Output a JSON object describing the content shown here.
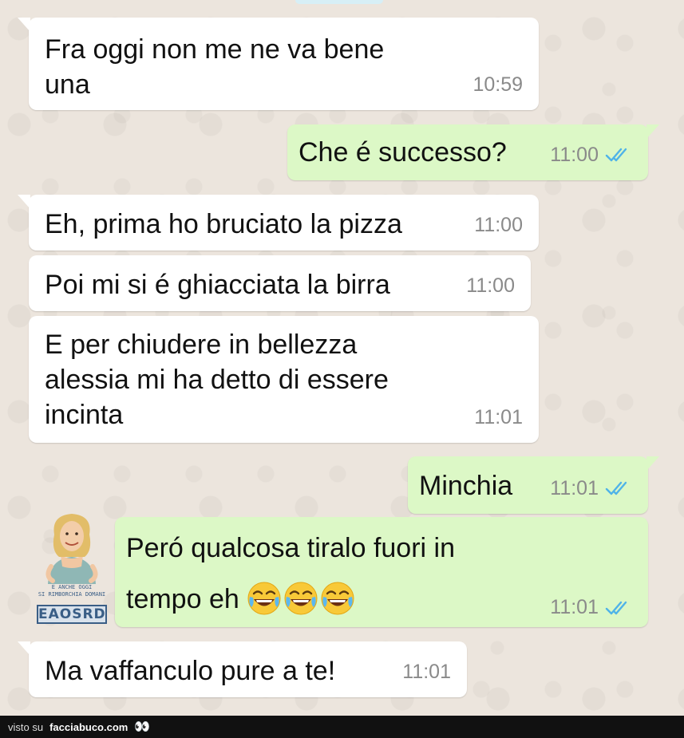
{
  "colors": {
    "incoming_bubble": "#ffffff",
    "outgoing_bubble": "#dcf8c6",
    "chat_background": "#ece5dd",
    "read_ticks": "#4fb3e8",
    "timestamp": "#8a8a8a"
  },
  "messages": [
    {
      "direction": "incoming",
      "text": "Fra oggi non me ne va bene una",
      "time": "10:59"
    },
    {
      "direction": "outgoing",
      "text": "Che é successo?",
      "time": "11:00",
      "status": "read"
    },
    {
      "direction": "incoming",
      "text": "Eh, prima ho bruciato la pizza",
      "time": "11:00"
    },
    {
      "direction": "incoming",
      "text": "Poi mi si é ghiacciata la birra",
      "time": "11:00"
    },
    {
      "direction": "incoming",
      "text": "E per chiudere in bellezza alessia mi ha detto di essere incinta",
      "time": "11:01"
    },
    {
      "direction": "outgoing",
      "text": "Minchia",
      "time": "11:01",
      "status": "read"
    },
    {
      "direction": "outgoing",
      "text_line1": "Peró qualcosa tiralo fuori in",
      "text_line2": "tempo eh",
      "emojis": [
        "face-with-tears-of-joy",
        "face-with-tears-of-joy",
        "face-with-tears-of-joy"
      ],
      "time": "11:01",
      "status": "read"
    },
    {
      "direction": "incoming",
      "text": "Ma vaffanculo pure a te!",
      "time": "11:01"
    }
  ],
  "watermark": {
    "caption_line1": "E ANCHE OGGI",
    "caption_line2": "SI RIMBORCHIA DOMANI",
    "brand": "EAOSRD"
  },
  "footer": {
    "prefix": "visto su",
    "site": "facciabuco.com",
    "logo_glyph": "👀"
  }
}
